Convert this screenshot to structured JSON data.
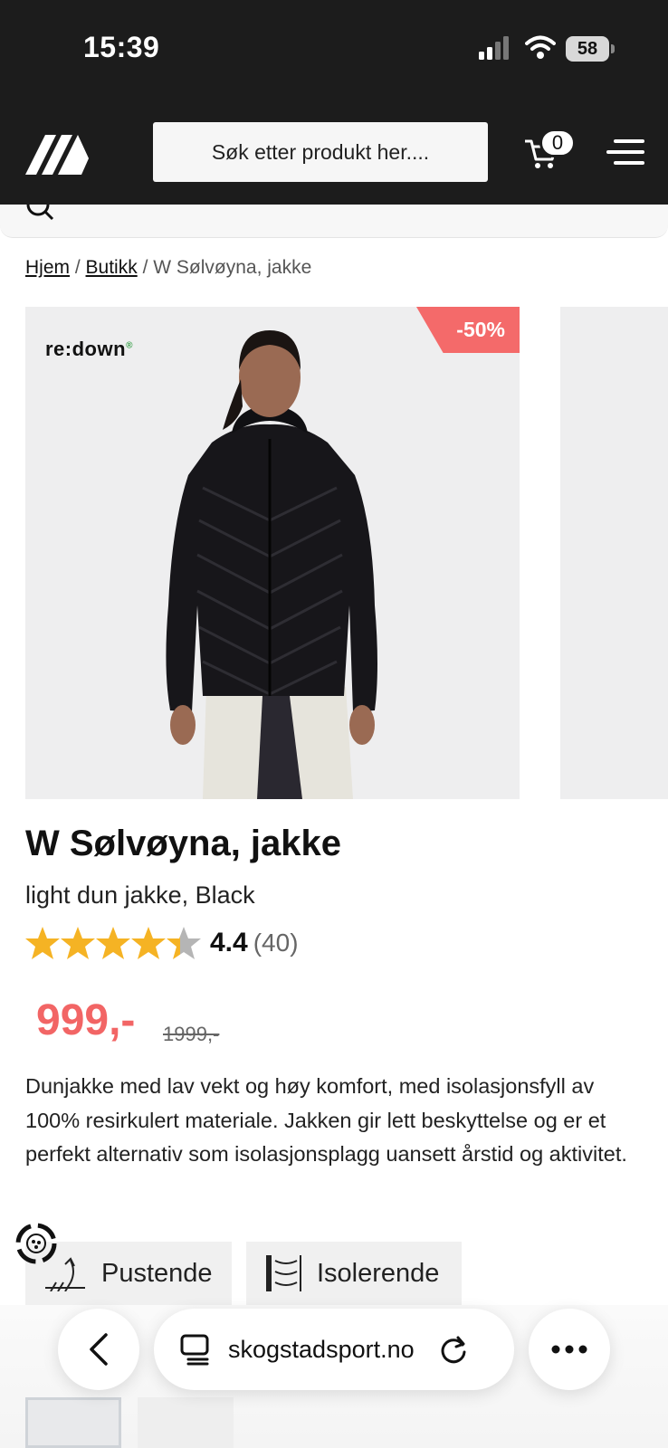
{
  "status_bar": {
    "time": "15:39",
    "battery": "58"
  },
  "header": {
    "search_placeholder": "Søk etter produkt her....",
    "cart_count": "0"
  },
  "breadcrumb": {
    "home": "Hjem",
    "shop": "Butikk",
    "current": "W Sølvøyna, jakke"
  },
  "product": {
    "brand": "re:down",
    "discount": "-50%",
    "title": "W Sølvøyna, jakke",
    "subtitle": "light dun jakke, Black",
    "rating": {
      "value": "4.4",
      "count": "(40)",
      "stars": 4.4
    },
    "price": "999,-",
    "old_price": "1999,-",
    "description": "Dunjakke med lav vekt og høy komfort, med isolasjonsfyll av 100% resirkulert materiale. Jakken gir lett beskyttelse og er et perfekt alternativ som isolasjonsplagg uansett årstid og aktivitet.",
    "features": [
      "Pustende",
      "Isolerende"
    ]
  },
  "browser": {
    "url": "skogstadsport.no"
  },
  "colors": {
    "header_bg": "#1c1c1c",
    "accent": "#f26565",
    "discount_bg": "#f46a6a",
    "star": "#f5b324"
  }
}
